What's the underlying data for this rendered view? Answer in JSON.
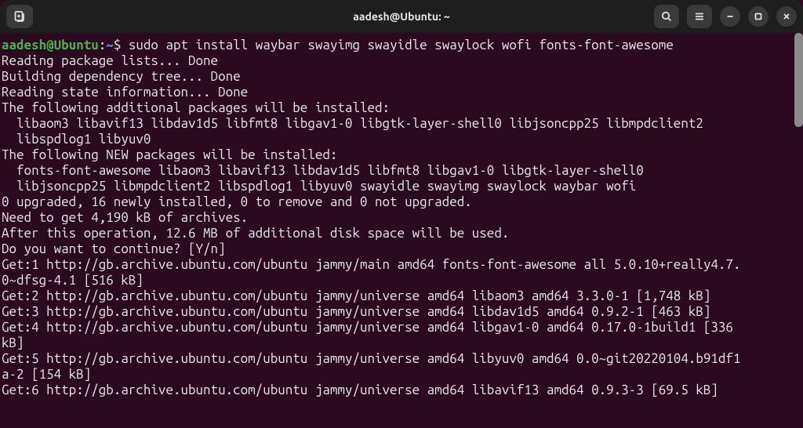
{
  "titlebar": {
    "title": "aadesh@Ubuntu: ~"
  },
  "prompt": {
    "user_host": "aadesh@Ubuntu",
    "path": "~",
    "command": "sudo apt install waybar swayimg swayidle swaylock wofi fonts-font-awesome"
  },
  "output_lines": [
    "Reading package lists... Done",
    "Building dependency tree... Done",
    "Reading state information... Done",
    "The following additional packages will be installed:",
    "  libaom3 libavif13 libdav1d5 libfmt8 libgav1-0 libgtk-layer-shell0 libjsoncpp25 libmpdclient2",
    "  libspdlog1 libyuv0",
    "The following NEW packages will be installed:",
    "  fonts-font-awesome libaom3 libavif13 libdav1d5 libfmt8 libgav1-0 libgtk-layer-shell0",
    "  libjsoncpp25 libmpdclient2 libspdlog1 libyuv0 swayidle swayimg swaylock waybar wofi",
    "0 upgraded, 16 newly installed, 0 to remove and 0 not upgraded.",
    "Need to get 4,190 kB of archives.",
    "After this operation, 12.6 MB of additional disk space will be used.",
    "Do you want to continue? [Y/n]",
    "Get:1 http://gb.archive.ubuntu.com/ubuntu jammy/main amd64 fonts-font-awesome all 5.0.10+really4.7.",
    "0~dfsg-4.1 [516 kB]",
    "Get:2 http://gb.archive.ubuntu.com/ubuntu jammy/universe amd64 libaom3 amd64 3.3.0-1 [1,748 kB]",
    "Get:3 http://gb.archive.ubuntu.com/ubuntu jammy/universe amd64 libdav1d5 amd64 0.9.2-1 [463 kB]",
    "Get:4 http://gb.archive.ubuntu.com/ubuntu jammy/universe amd64 libgav1-0 amd64 0.17.0-1build1 [336",
    "kB]",
    "Get:5 http://gb.archive.ubuntu.com/ubuntu jammy/universe amd64 libyuv0 amd64 0.0~git20220104.b91df1",
    "a-2 [154 kB]",
    "Get:6 http://gb.archive.ubuntu.com/ubuntu jammy/universe amd64 libavif13 amd64 0.9.3-3 [69.5 kB]"
  ]
}
